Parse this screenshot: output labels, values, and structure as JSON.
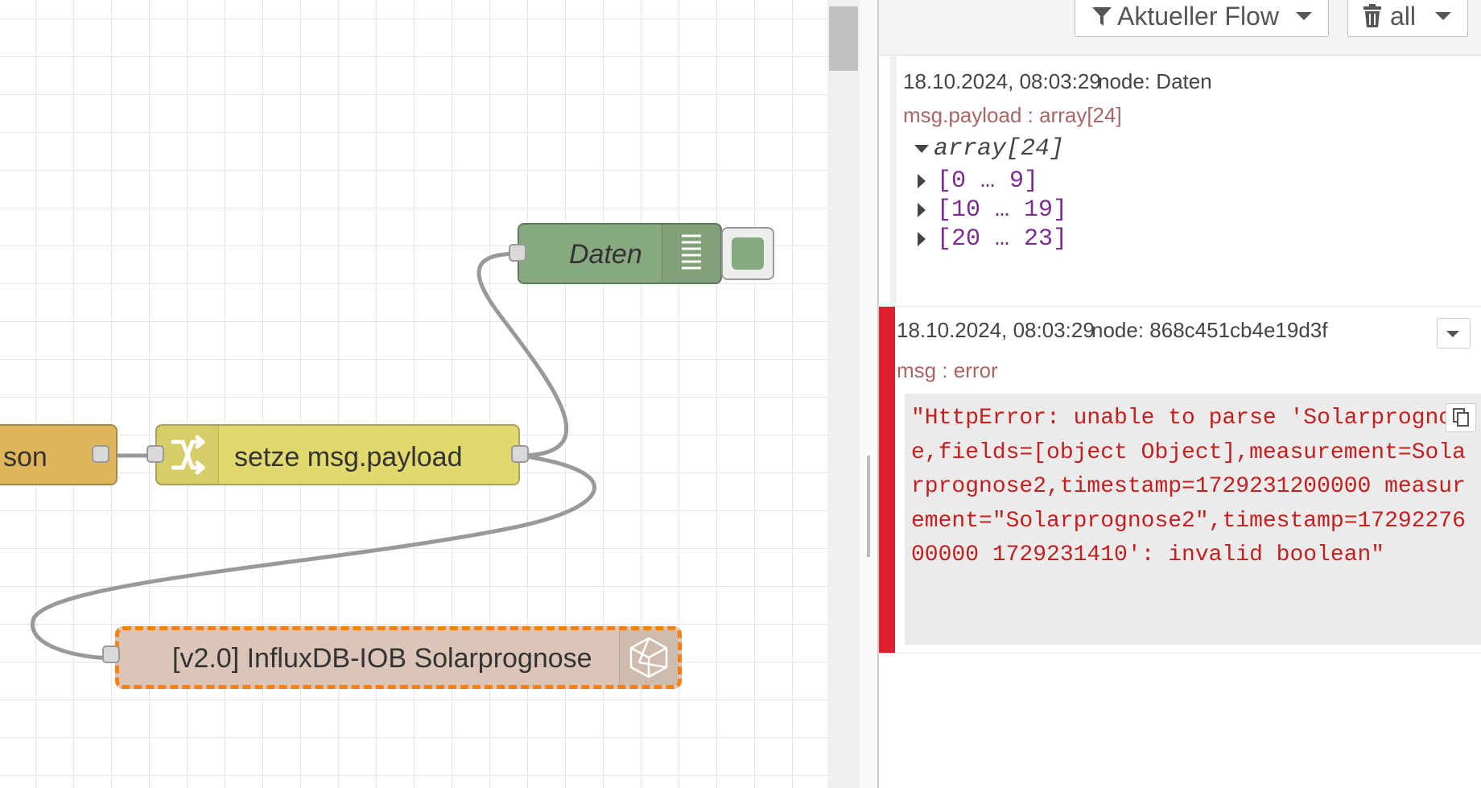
{
  "workspace": {
    "nodes": {
      "json": {
        "label": "son"
      },
      "change": {
        "label": "setze msg.payload"
      },
      "debug": {
        "label": "Daten"
      },
      "influx": {
        "label": "[v2.0] InfluxDB-IOB Solarprognose"
      }
    }
  },
  "sidebar": {
    "filter_label": "Aktueller Flow",
    "clear_label": "all",
    "messages": [
      {
        "timestamp": "18.10.2024, 08:03:29",
        "node": "node: Daten",
        "path": "msg.payload : array[24]",
        "tree_root": "array[24]",
        "tree_items": [
          "[0 … 9]",
          "[10 … 19]",
          "[20 … 23]"
        ]
      },
      {
        "timestamp": "18.10.2024, 08:03:29",
        "node": "node: 868c451cb4e19d3f",
        "path": "msg : error",
        "value": "\"HttpError: unable to parse 'Solarprognose,fields=[object Object],measurement=Solarprognose2,timestamp=1729231200000 measurement=\"Solarprognose2\",timestamp=1729227600000 1729231410': invalid boolean\""
      }
    ]
  },
  "colors": {
    "json_node": "#deb55a",
    "change_node": "#e2d96e",
    "debug_node": "#87a980",
    "influx_node": "#dbc4b8",
    "selection": "#ff7f0e",
    "error_bar": "#e0202e",
    "error_text": "#c41e1e",
    "path_text": "#aa6666",
    "tree_text": "#7b2c91"
  }
}
